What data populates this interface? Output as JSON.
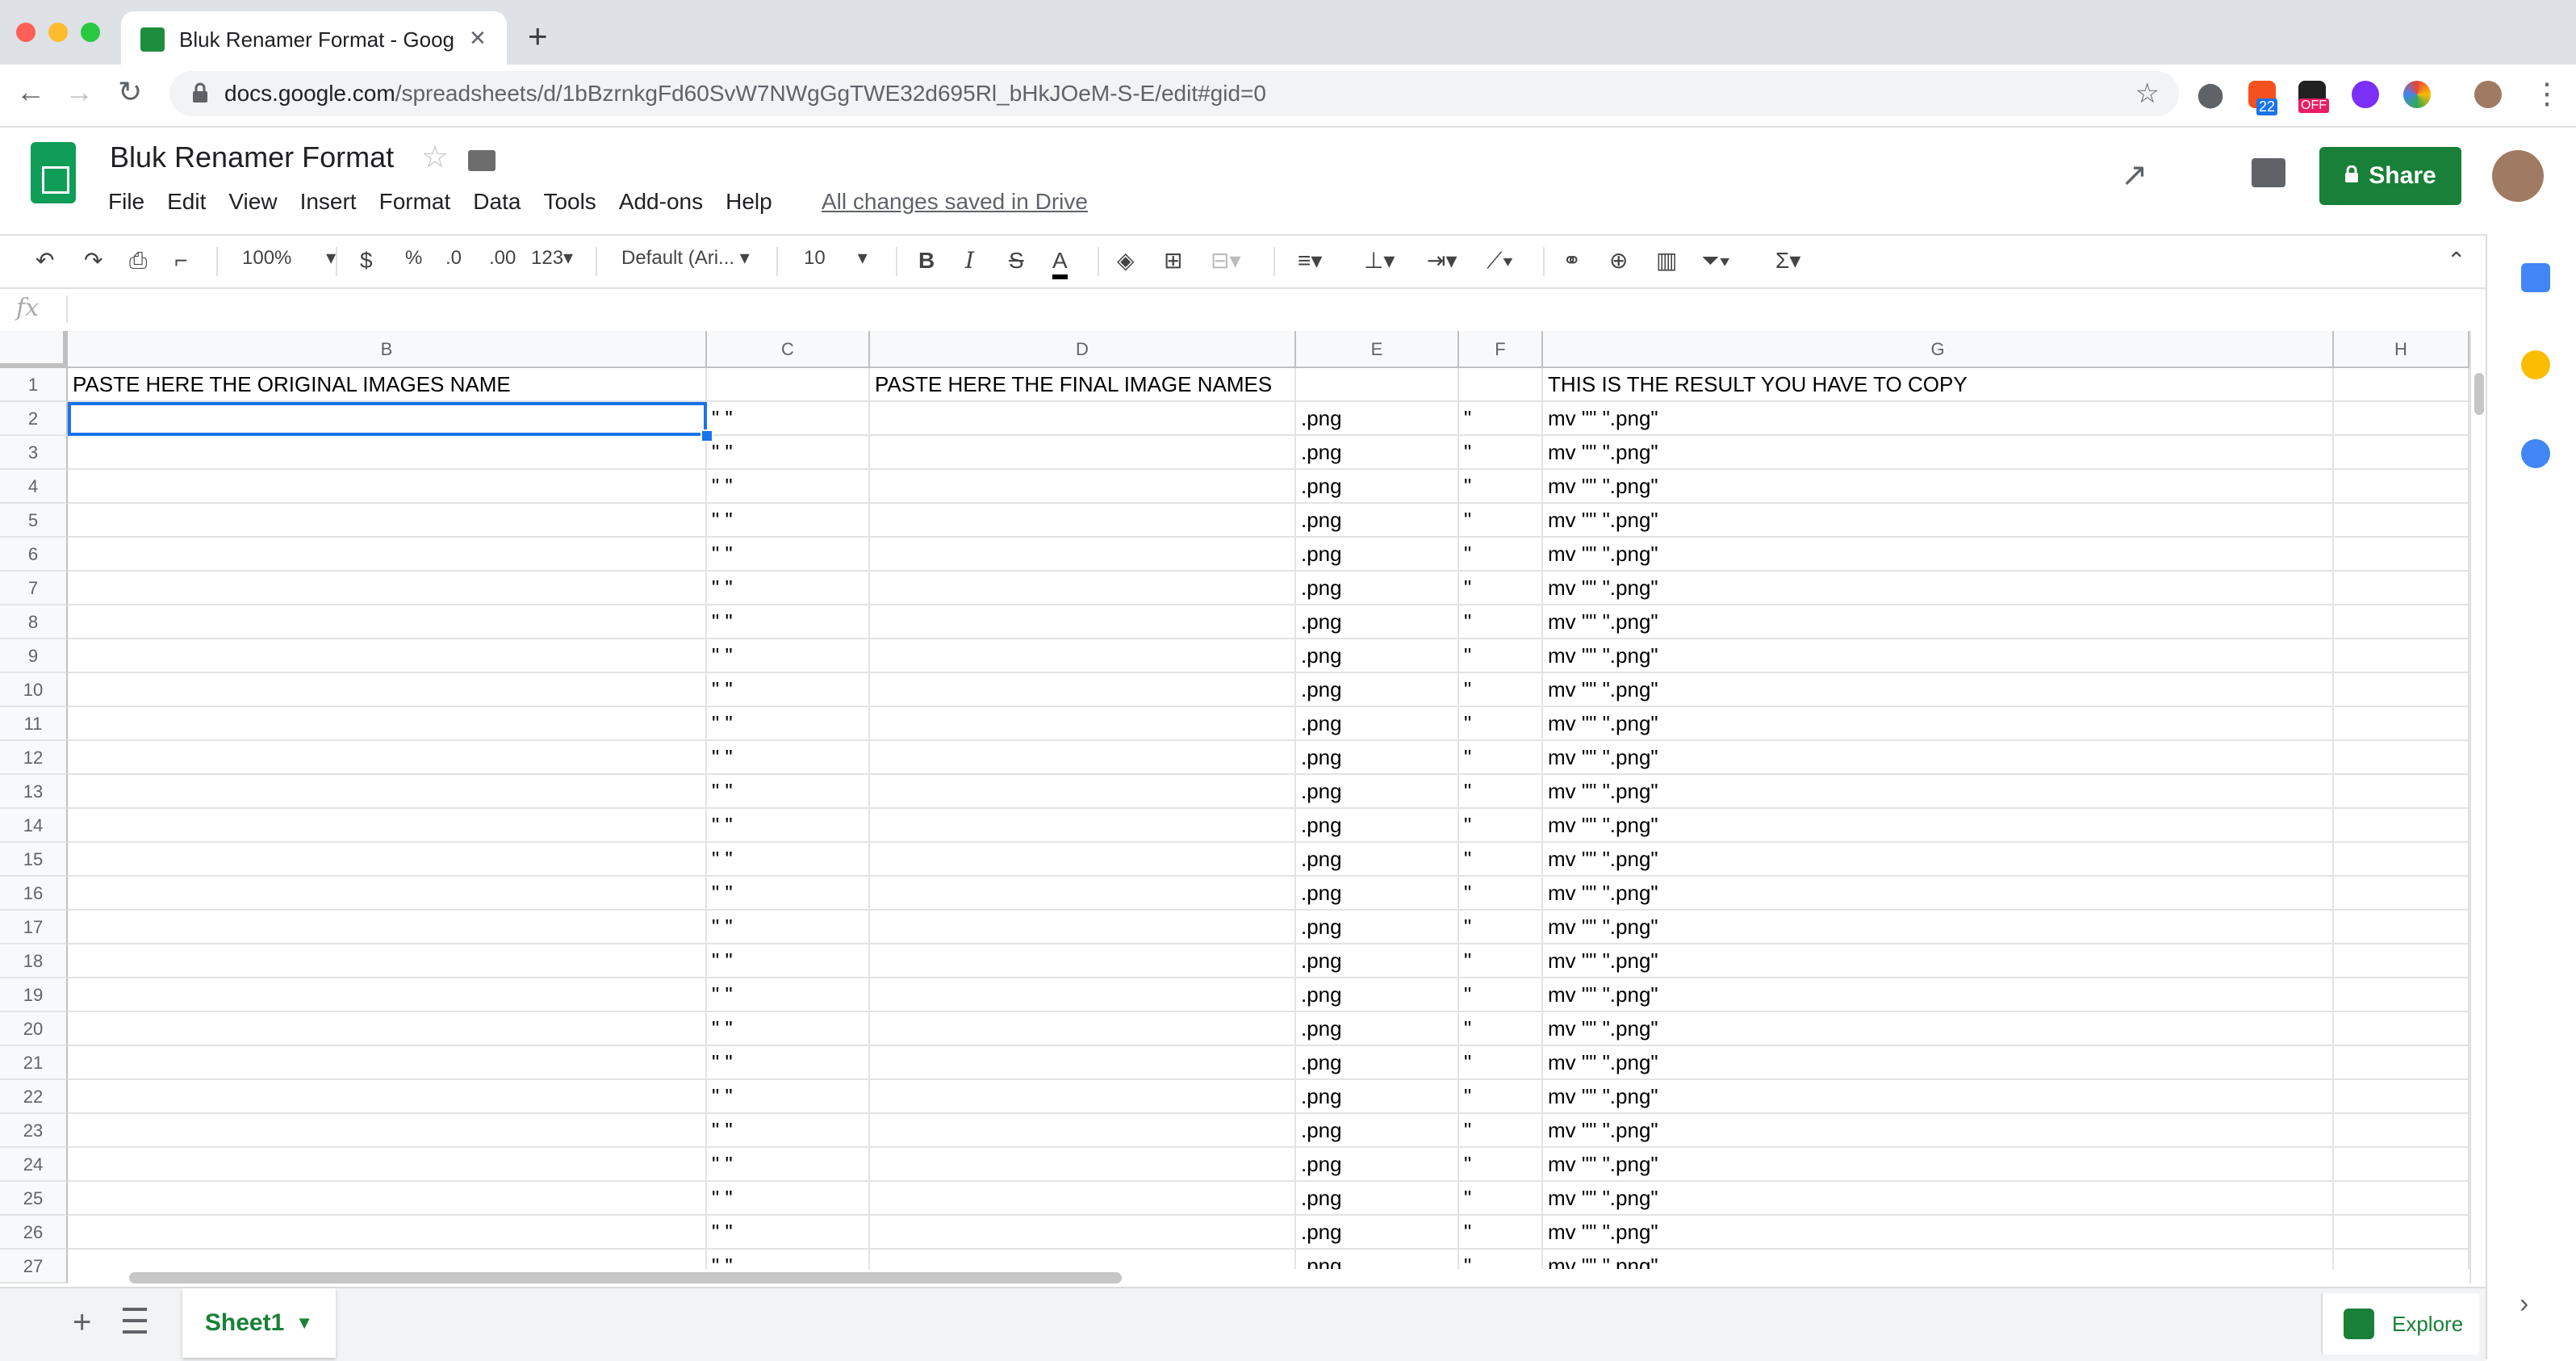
{
  "browser": {
    "tab_title": "Bluk Renamer Format - Google",
    "new_tab": "+",
    "url_host": "docs.google.com",
    "url_path": "/spreadsheets/d/1bBzrnkgFd60SvW7NWgGgTWE32d695Rl_bHkJOeM-S-E/edit#gid=0",
    "ext_badge_1": "22",
    "ext_badge_2": "OFF"
  },
  "doc": {
    "title": "Bluk Renamer Format",
    "saved_status": "All changes saved in Drive",
    "share_label": "Share"
  },
  "menu": [
    "File",
    "Edit",
    "View",
    "Insert",
    "Format",
    "Data",
    "Tools",
    "Add-ons",
    "Help"
  ],
  "toolbar": {
    "zoom": "100%",
    "currency": "$",
    "percent": "%",
    "dec_less": ".0",
    "dec_more": ".00",
    "more_formats": "123",
    "font": "Default (Ari...",
    "font_size": "10",
    "bold": "B",
    "italic": "I",
    "strike": "S",
    "text_color": "A",
    "functions": "Σ"
  },
  "formula_bar": {
    "label": "fx"
  },
  "columns": [
    "B",
    "C",
    "D",
    "E",
    "F",
    "G",
    "H"
  ],
  "row_numbers": [
    "1",
    "2",
    "3",
    "4",
    "5",
    "6",
    "7",
    "8",
    "9",
    "10",
    "11",
    "12",
    "13",
    "14",
    "15",
    "16",
    "17",
    "18",
    "19",
    "20",
    "21",
    "22",
    "23",
    "24",
    "25",
    "26",
    "27"
  ],
  "header_row": {
    "B": "PASTE HERE THE ORIGINAL IMAGES NAME",
    "D": "PASTE HERE THE FINAL IMAGE NAMES",
    "G": "THIS IS THE RESULT YOU HAVE TO COPY"
  },
  "repeat_row": {
    "C": "\" \"",
    "E": ".png",
    "F": "\"",
    "G": "mv \"\" \".png\""
  },
  "sheet_tab": "Sheet1",
  "explore_label": "Explore",
  "colors": {
    "brand": "#188038",
    "selection": "#1a73e8"
  }
}
